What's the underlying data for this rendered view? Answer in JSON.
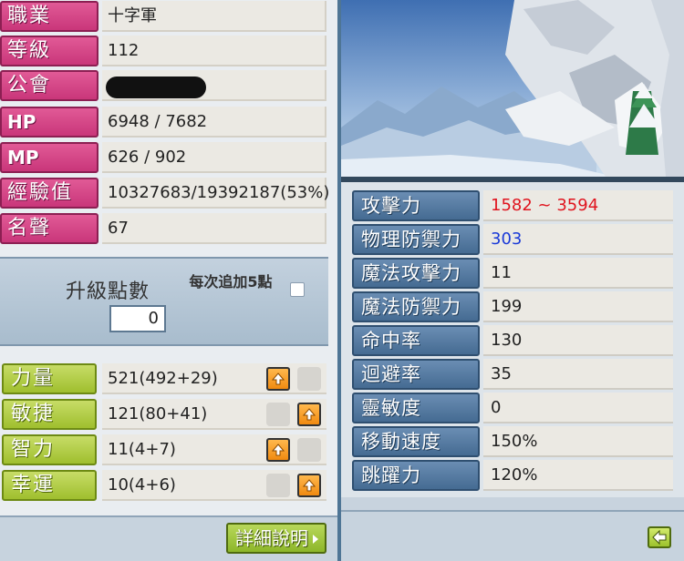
{
  "info": [
    {
      "label": "職業",
      "value": "十字軍"
    },
    {
      "label": "等級",
      "value": "112"
    },
    {
      "label": "公會",
      "value": ""
    },
    {
      "label": "HP",
      "value": "6948 / 7682"
    },
    {
      "label": "MP",
      "value": "626 / 902"
    },
    {
      "label": "經驗值",
      "value": "10327683/19392187(53%)"
    },
    {
      "label": "名聲",
      "value": "67"
    }
  ],
  "ap": {
    "title": "升級點數",
    "value": "0",
    "auto_label": "每次追加5點",
    "auto_checked": false
  },
  "stats": [
    {
      "label": "力量",
      "value": "521(492+29)"
    },
    {
      "label": "敏捷",
      "value": "121(80+41)"
    },
    {
      "label": "智力",
      "value": "11(4+7)"
    },
    {
      "label": "幸運",
      "value": "10(4+6)"
    }
  ],
  "detail_button": "詳細說明",
  "detail_stats": [
    {
      "label": "攻擊力",
      "value": "1582 ~ 3594",
      "color": "#e0141e"
    },
    {
      "label": "物理防禦力",
      "value": "303",
      "color": "#1a3ad8"
    },
    {
      "label": "魔法攻擊力",
      "value": "11",
      "color": "#222222"
    },
    {
      "label": "魔法防禦力",
      "value": "199",
      "color": "#222222"
    },
    {
      "label": "命中率",
      "value": "130",
      "color": "#222222"
    },
    {
      "label": "迴避率",
      "value": "35",
      "color": "#222222"
    },
    {
      "label": "靈敏度",
      "value": "0",
      "color": "#222222"
    },
    {
      "label": "移動速度",
      "value": "150%",
      "color": "#222222"
    },
    {
      "label": "跳躍力",
      "value": "120%",
      "color": "#222222"
    }
  ],
  "colors": {
    "info_label": "#d6468a",
    "stat_label": "#9fbf2e",
    "detail_label": "#5a7ea6",
    "up_button": "#f5a020"
  },
  "icons": {
    "up_button": "arrow-up-icon",
    "back_button": "arrow-left-icon",
    "detail_arrow": "triangle-right-icon"
  }
}
